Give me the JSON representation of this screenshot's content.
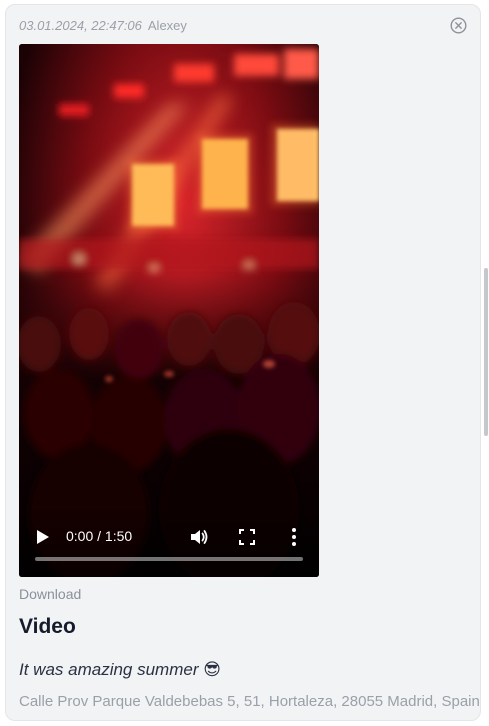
{
  "message": {
    "timestamp": "03.01.2024, 22:47:06",
    "author": "Alexey",
    "title": "Video",
    "caption": "It was amazing summer 😎",
    "address": "Calle Prov Parque Valdebebas 5, 51, Hortaleza, 28055 Madrid, Spain",
    "download_label": "Download"
  },
  "video_player": {
    "time_display": "0:00 / 1:50",
    "progress_fraction": 0.0,
    "icons": {
      "play": "play-icon",
      "volume": "volume-icon",
      "fullscreen": "fullscreen-icon",
      "more": "more-vertical-icon"
    }
  },
  "icons": {
    "close": "close-circle-icon"
  },
  "colors": {
    "card_background": "#f2f3f5",
    "muted_text": "#9aa0a8",
    "title_text": "#161b2b"
  }
}
